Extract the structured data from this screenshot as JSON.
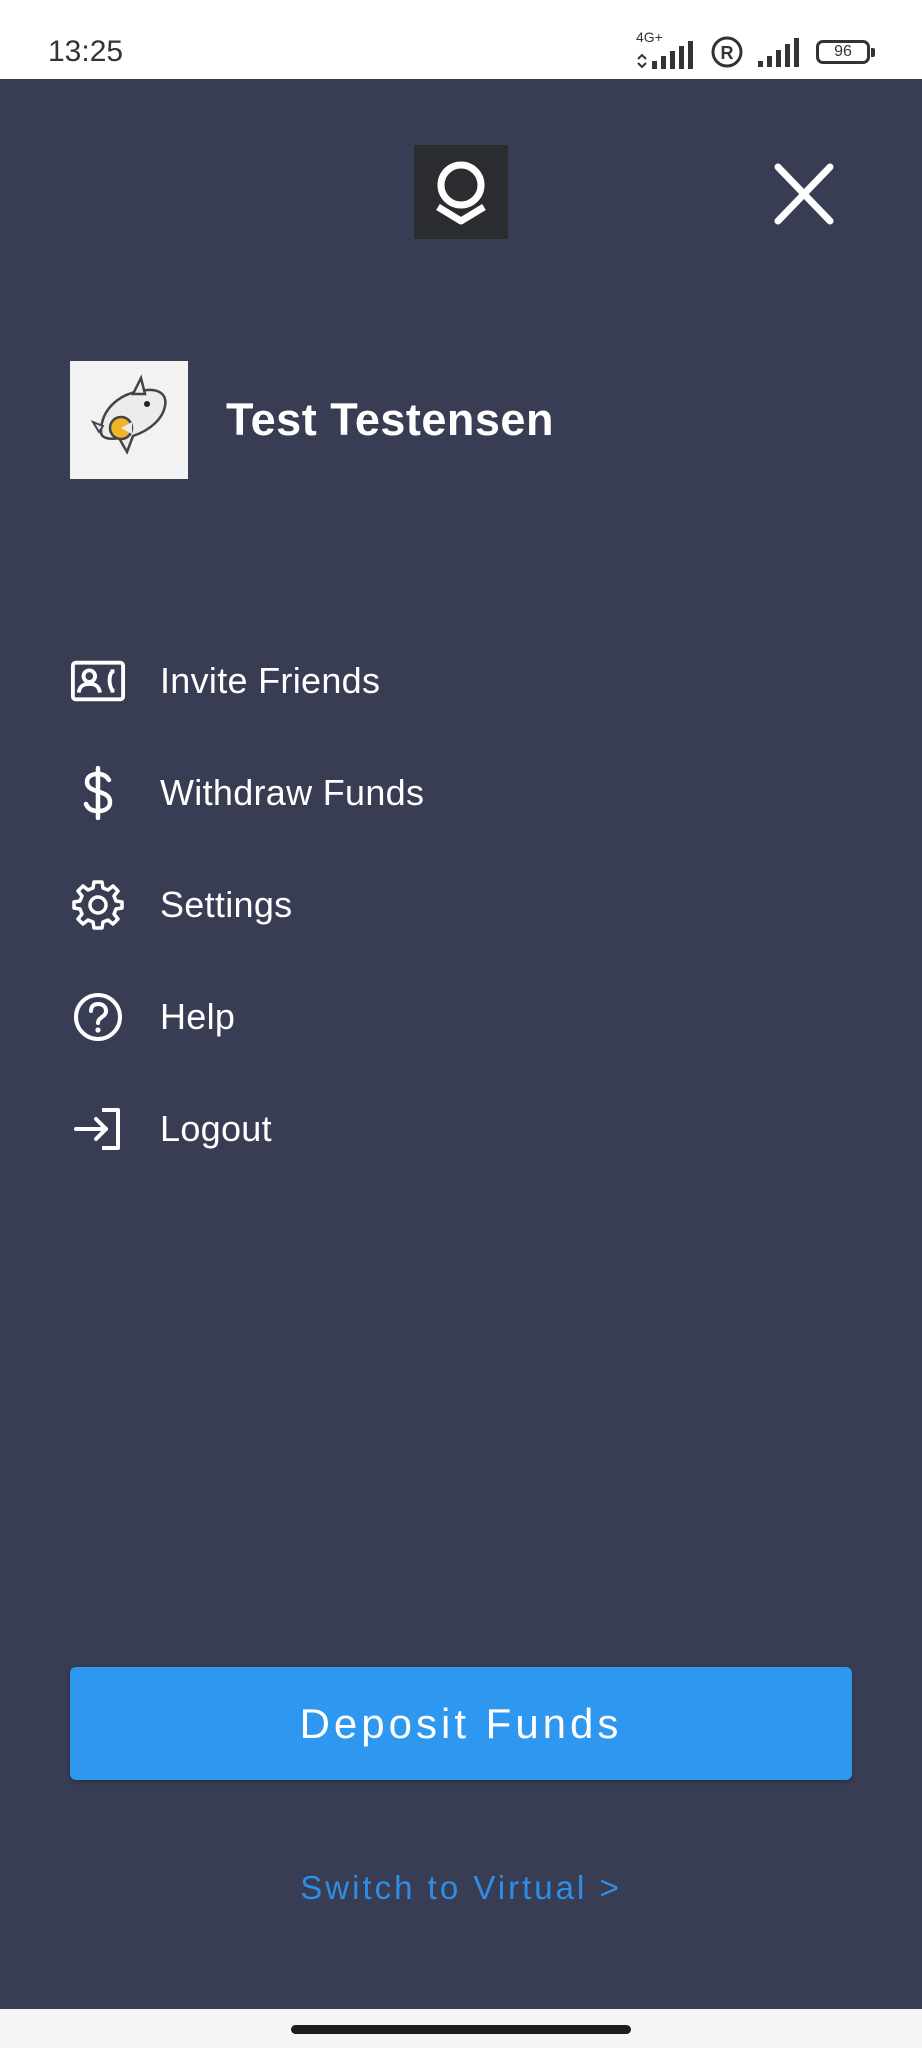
{
  "status_bar": {
    "time": "13:25",
    "network_label": "4G+",
    "battery_level": "96",
    "icons": [
      "signal-icon",
      "roaming-icon",
      "signal-icon",
      "battery-icon"
    ]
  },
  "header": {
    "logo_icon": "brand-logo-icon",
    "close_icon": "close-icon"
  },
  "profile": {
    "name": "Test Testensen",
    "avatar_icon": "shark-avatar"
  },
  "menu": {
    "items": [
      {
        "label": "Invite Friends",
        "icon": "contact-card-icon"
      },
      {
        "label": "Withdraw Funds",
        "icon": "dollar-icon"
      },
      {
        "label": "Settings",
        "icon": "gear-icon"
      },
      {
        "label": "Help",
        "icon": "help-circle-icon"
      },
      {
        "label": "Logout",
        "icon": "logout-icon"
      }
    ]
  },
  "actions": {
    "deposit_label": "Deposit Funds",
    "switch_label": "Switch to Virtual >"
  },
  "colors": {
    "drawer_bg": "#383d53",
    "primary_button": "#2e97f0",
    "link": "#2e8ee6",
    "text": "#ffffff"
  }
}
